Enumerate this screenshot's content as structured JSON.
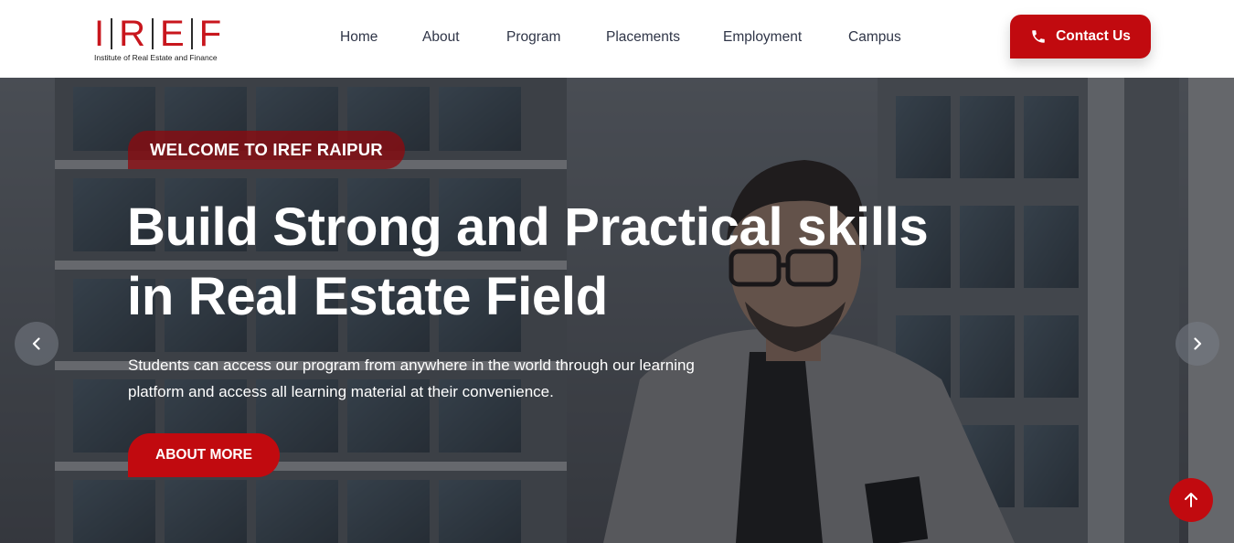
{
  "header": {
    "logo": {
      "letters": [
        "I",
        "R",
        "E",
        "F"
      ],
      "tagline": "Institute of Real Estate and Finance"
    },
    "nav": {
      "items": [
        "Home",
        "About",
        "Program",
        "Placements",
        "Employment",
        "Campus"
      ]
    },
    "contact_button": {
      "label": "Contact Us",
      "icon": "phone-icon"
    }
  },
  "hero": {
    "badge": "WELCOME TO IREF RAIPUR",
    "headline": {
      "line1": "Build Strong and Practical skills",
      "line2": "in Real Estate Field"
    },
    "subtext": {
      "line1": "Students can access our program from anywhere in the world through our learning",
      "line2": "platform and access all learning material at their convenience."
    },
    "cta_label": "ABOUT MORE",
    "prev_icon": "chevron-left-icon",
    "next_icon": "chevron-right-icon"
  },
  "back_to_top": {
    "icon": "arrow-up-icon"
  },
  "colors": {
    "brand_red": "#c10a0f",
    "logo_red": "#c8161d",
    "nav_text": "#2f3547",
    "badge_bg": "#8c0a10"
  }
}
